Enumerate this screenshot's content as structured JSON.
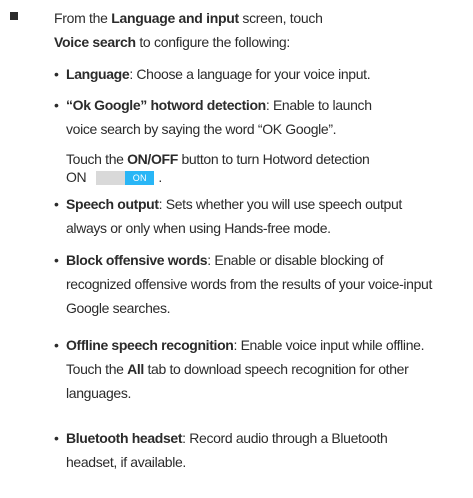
{
  "intro": {
    "line1_pre": "From the ",
    "line1_bold": "Language and input",
    "line1_post": " screen, touch",
    "line2_bold": "Voice search",
    "line2_post": " to configure the following:"
  },
  "items": [
    {
      "term": "Language",
      "lines": [
        ": Choose a language for your voice input."
      ]
    },
    {
      "term": "“Ok Google” hotword detection",
      "lines": [
        ": Enable to launch",
        "voice search by saying the word “OK Google”."
      ]
    },
    {
      "term": "Speech output",
      "lines": [
        ": Sets whether you will use speech output",
        "always or only when using Hands-free mode."
      ]
    },
    {
      "term": "Block offensive words",
      "lines": [
        ": Enable or disable blocking of",
        "recognized offensive words from the results of your voice-input",
        "Google searches."
      ]
    },
    {
      "term": "Offline speech recognition",
      "lines": [
        ": Enable voice input while offline."
      ]
    },
    {
      "term": "Bluetooth headset",
      "lines": [
        ": Record audio through a Bluetooth",
        "headset, if available."
      ]
    }
  ],
  "hotword_note": {
    "pre": "Touch the ",
    "bold": "ON/OFF",
    "post": " button to turn Hotword detection",
    "line2": "ON",
    "toggle_label": "ON",
    "period": "."
  },
  "offline_note": {
    "pre": "Touch the ",
    "bold": "All",
    "post": " tab to download speech recognition for other",
    "line2": "languages."
  },
  "colors": {
    "text": "#2b2b2b",
    "toggle_on": "#29b6f6",
    "toggle_track": "#d9d9d9"
  }
}
